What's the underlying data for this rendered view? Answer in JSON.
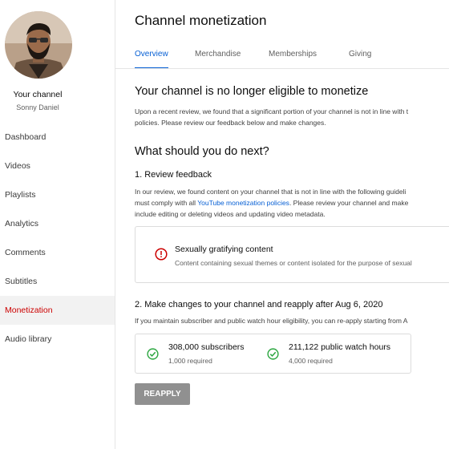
{
  "sidebar": {
    "channel_label": "Your channel",
    "channel_name": "Sonny Daniel",
    "items": [
      {
        "label": "Dashboard",
        "active": false
      },
      {
        "label": "Videos",
        "active": false
      },
      {
        "label": "Playlists",
        "active": false
      },
      {
        "label": "Analytics",
        "active": false
      },
      {
        "label": "Comments",
        "active": false
      },
      {
        "label": "Subtitles",
        "active": false
      },
      {
        "label": "Monetization",
        "active": true
      },
      {
        "label": "Audio library",
        "active": false
      }
    ]
  },
  "header": {
    "title": "Channel monetization",
    "tabs": [
      "Overview",
      "Merchandise",
      "Memberships",
      "Giving"
    ],
    "active_tab": "Overview"
  },
  "main": {
    "status_heading": "Your channel is no longer eligible to monetize",
    "status_line1": "Upon a recent review, we found that a significant portion of your channel is not in line with t",
    "status_line2": "policies. Please review our feedback below and make changes.",
    "next_heading": "What should you do next?",
    "step1_heading": "1. Review feedback",
    "step1_line1": "In our review, we found content on your channel that is not in line with the following guideli",
    "step1_line2_pre": "must comply with all ",
    "step1_link": "YouTube monetization policies",
    "step1_line2_post": ". Please review your channel and make",
    "step1_line3": "include editing or deleting videos and updating video metadata.",
    "policy": {
      "title": "Sexually gratifying content",
      "description": "Content containing sexual themes or content isolated for the purpose of sexual"
    },
    "step2_heading": "2. Make changes to your channel and reapply after Aug 6, 2020",
    "step2_line": "If you maintain subscriber and public watch hour eligibility, you can re-apply starting from A",
    "requirements": [
      {
        "value": "308,000 subscribers",
        "required": "1,000 required"
      },
      {
        "value": "211,122 public watch hours",
        "required": "4,000 required"
      }
    ],
    "reapply_label": "REAPPLY"
  },
  "colors": {
    "accent": "#065fd4",
    "active_nav": "#cc0000",
    "check": "#2ba640",
    "warning": "#cc0000",
    "button_disabled": "#909090"
  },
  "icons": {
    "policy": "error-circle-icon",
    "requirement_met": "check-circle-icon"
  }
}
